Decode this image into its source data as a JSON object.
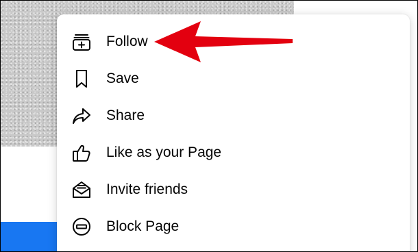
{
  "colors": {
    "accent_blue": "#1877f2",
    "arrow_red": "#e3000f",
    "text": "#050505"
  },
  "menu": {
    "items": [
      {
        "label": "Follow",
        "icon": "follow-icon"
      },
      {
        "label": "Save",
        "icon": "bookmark-icon"
      },
      {
        "label": "Share",
        "icon": "share-icon"
      },
      {
        "label": "Like as your Page",
        "icon": "thumbs-up-icon"
      },
      {
        "label": "Invite friends",
        "icon": "invite-envelope-icon"
      },
      {
        "label": "Block Page",
        "icon": "block-icon"
      }
    ]
  },
  "annotation": {
    "icon": "red-arrow-pointing-left"
  }
}
